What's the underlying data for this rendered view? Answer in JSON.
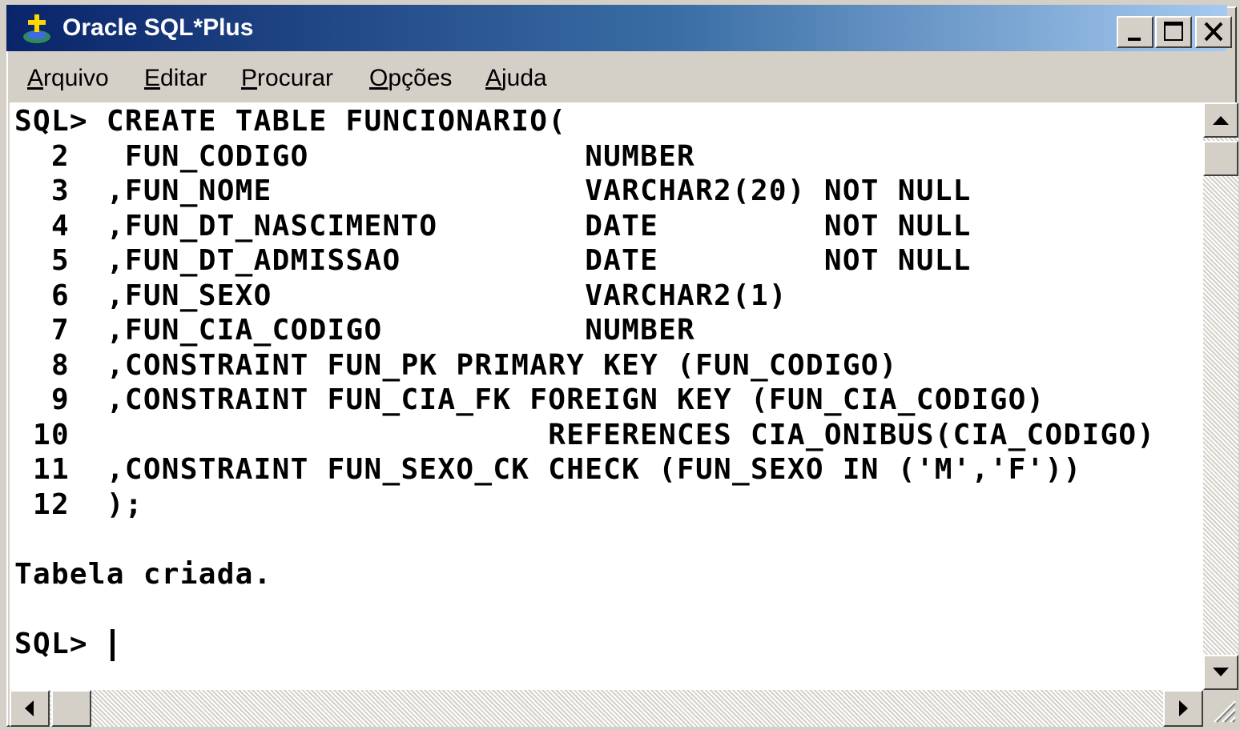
{
  "window": {
    "title": "Oracle SQL*Plus"
  },
  "menu": [
    {
      "mnemonic": "A",
      "rest": "rquivo"
    },
    {
      "mnemonic": "E",
      "rest": "ditar"
    },
    {
      "mnemonic": "P",
      "rest": "rocurar"
    },
    {
      "mnemonic": "O",
      "rest": "pções"
    },
    {
      "mnemonic": "A",
      "rest": "juda"
    }
  ],
  "console": {
    "lines": [
      "SQL> CREATE TABLE FUNCIONARIO(",
      "  2   FUN_CODIGO               NUMBER",
      "  3  ,FUN_NOME                 VARCHAR2(20) NOT NULL",
      "  4  ,FUN_DT_NASCIMENTO        DATE         NOT NULL",
      "  5  ,FUN_DT_ADMISSAO          DATE         NOT NULL",
      "  6  ,FUN_SEXO                 VARCHAR2(1)",
      "  7  ,FUN_CIA_CODIGO           NUMBER",
      "  8  ,CONSTRAINT FUN_PK PRIMARY KEY (FUN_CODIGO)",
      "  9  ,CONSTRAINT FUN_CIA_FK FOREIGN KEY (FUN_CIA_CODIGO)",
      " 10                          REFERENCES CIA_ONIBUS(CIA_CODIGO)",
      " 11  ,CONSTRAINT FUN_SEXO_CK CHECK (FUN_SEXO IN ('M','F'))",
      " 12  );",
      "",
      "Tabela criada.",
      "",
      "SQL> "
    ]
  },
  "icons": {
    "app": "oracle-sqlplus-icon",
    "minimize": "minimize-icon",
    "maximize": "maximize-icon",
    "close": "close-icon",
    "scroll_up": "arrow-up-icon",
    "scroll_down": "arrow-down-icon",
    "scroll_left": "arrow-left-icon",
    "scroll_right": "arrow-right-icon"
  },
  "colors": {
    "title_start": "#0a246a",
    "title_end": "#a6caf0",
    "chrome": "#d4d0c8",
    "console_bg": "#ffffff",
    "console_text": "#000000"
  }
}
